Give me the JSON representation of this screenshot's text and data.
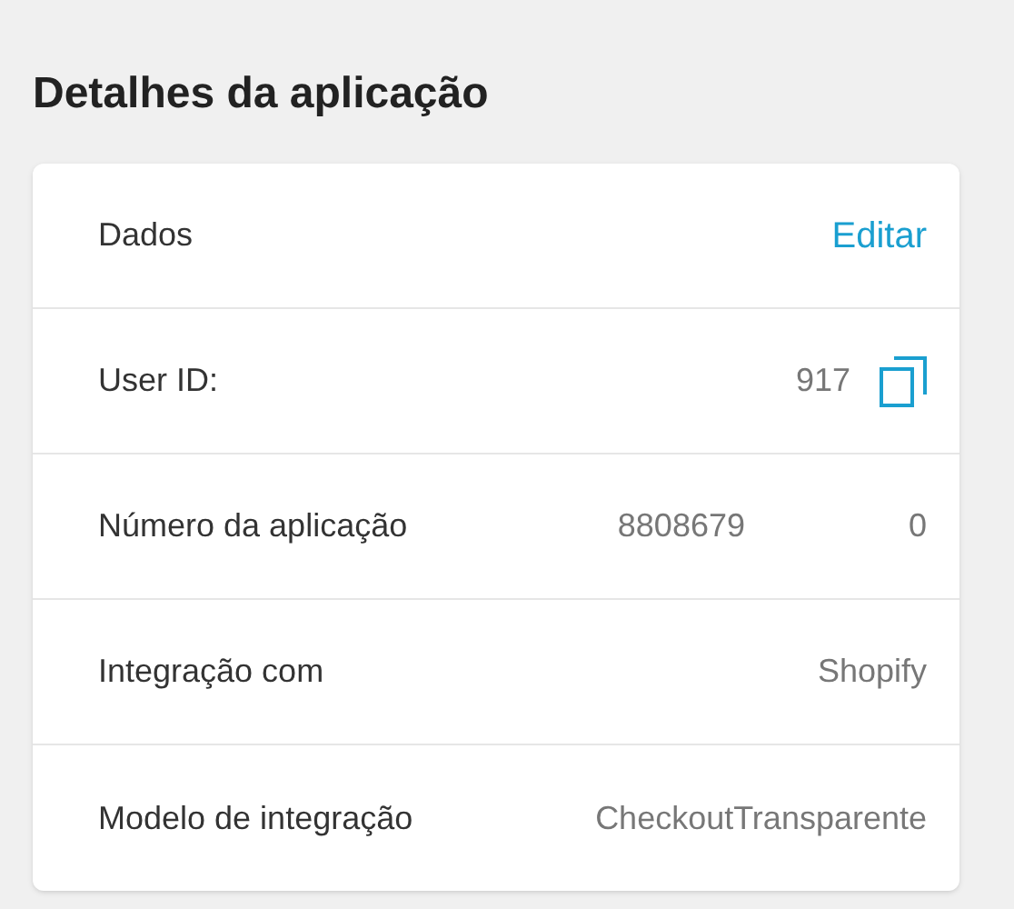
{
  "title": "Detalhes da aplicação",
  "rows": [
    {
      "kind": "header",
      "label": "Dados",
      "action": "Editar"
    },
    {
      "kind": "copy",
      "label": "User ID:",
      "value_parts": [
        "917"
      ]
    },
    {
      "kind": "value",
      "label": "Número da aplicação",
      "value_parts": [
        "8808679",
        "0"
      ]
    },
    {
      "kind": "value",
      "label": "Integração com",
      "value_parts": [
        "Shopify"
      ]
    },
    {
      "kind": "value",
      "label": "Modelo de integração",
      "value_parts": [
        "CheckoutTransparente"
      ]
    }
  ]
}
